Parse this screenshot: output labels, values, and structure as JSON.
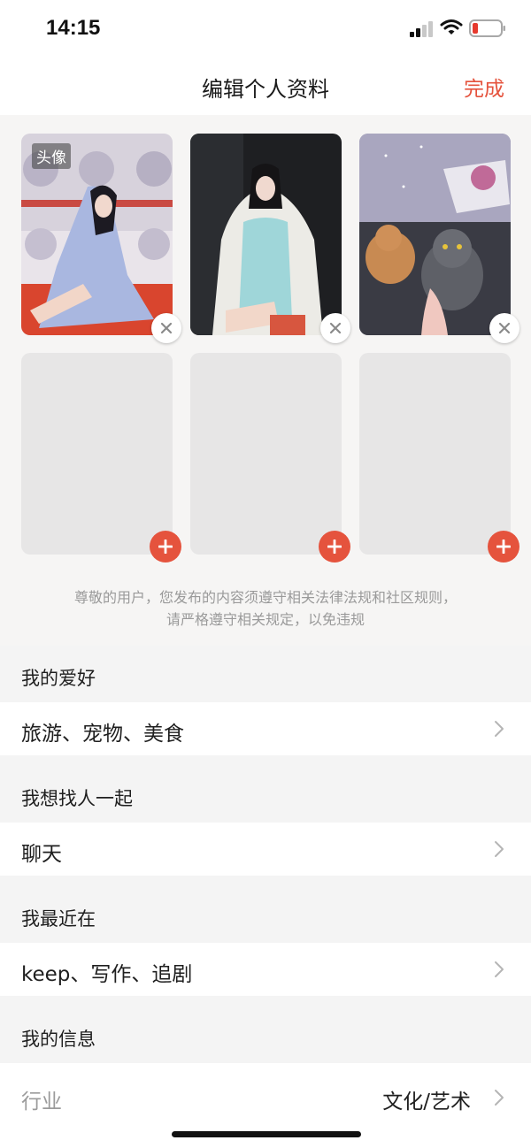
{
  "status_bar": {
    "time": "14:15"
  },
  "nav": {
    "title": "编辑个人资料",
    "done_label": "完成"
  },
  "photos": {
    "avatar_tag": "头像",
    "notice_line1": "尊敬的用户，您发布的内容须遵守相关法律法规和社区规则，",
    "notice_line2": "请严格遵守相关规定，以免违规"
  },
  "sections": {
    "hobbies": {
      "title": "我的爱好",
      "value": "旅游、宠物、美食"
    },
    "find_together": {
      "title": "我想找人一起",
      "value": "聊天"
    },
    "recently": {
      "title": "我最近在",
      "value": "keep、写作、追剧"
    },
    "my_info": {
      "title": "我的信息",
      "industry_label": "行业",
      "industry_value": "文化/艺术"
    }
  },
  "colors": {
    "accent": "#e5533d",
    "empty_slot": "#e7e6e6",
    "background": "#f4f4f4"
  },
  "icons": {
    "status": [
      "signal-icon",
      "wifi-icon",
      "battery-low-icon"
    ],
    "photo_actions": [
      "close-icon",
      "plus-icon"
    ],
    "row": "chevron-right-icon"
  }
}
